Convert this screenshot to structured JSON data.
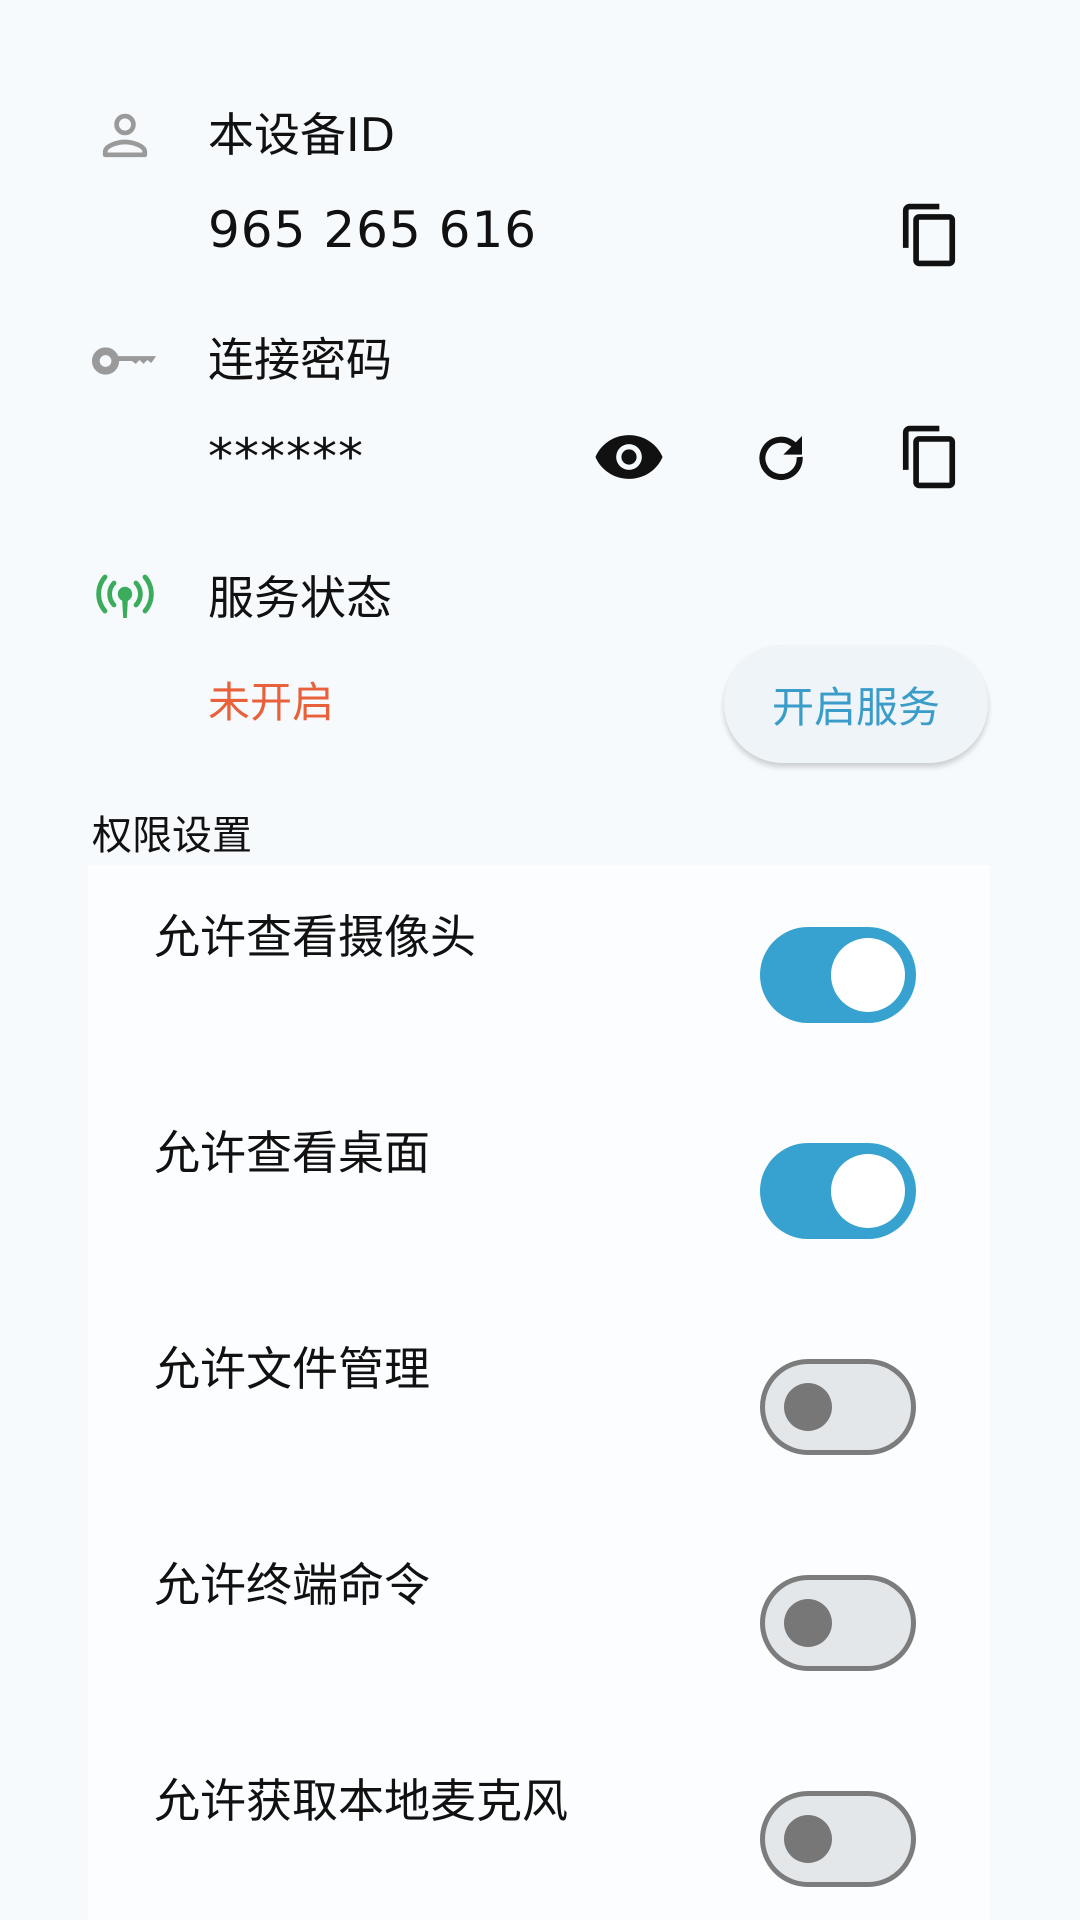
{
  "device": {
    "label": "本设备ID",
    "id": "965 265 616",
    "person_icon": "person-outline-icon",
    "copy_icon": "copy-icon"
  },
  "password": {
    "label": "连接密码",
    "value": "******",
    "key_icon": "key-icon",
    "show_icon": "eye-icon",
    "refresh_icon": "refresh-icon",
    "copy_icon": "copy-icon"
  },
  "service": {
    "label": "服务状态",
    "status": "未开启",
    "status_color": "#e8613a",
    "start_button": "开启服务",
    "icon": "broadcast-icon",
    "icon_color": "#3aac5c"
  },
  "permissions": {
    "title": "权限设置",
    "accent": "#37a2cf",
    "items": [
      {
        "label": "允许查看摄像头",
        "enabled": true
      },
      {
        "label": "允许查看桌面",
        "enabled": true
      },
      {
        "label": "允许文件管理",
        "enabled": false
      },
      {
        "label": "允许终端命令",
        "enabled": false
      },
      {
        "label": "允许获取本地麦克风",
        "enabled": false
      }
    ]
  }
}
